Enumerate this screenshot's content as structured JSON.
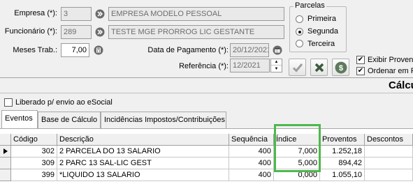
{
  "form": {
    "empresa": {
      "label": "Empresa (*):",
      "code": "3",
      "name": "EMPRESA MODELO PESSOAL"
    },
    "funcionario": {
      "label": "Funcionário (*):",
      "code": "289",
      "name": "TESTE MGE PRORROG LIC GESTANTE"
    },
    "meses_trab": {
      "label": "Meses Trab.:",
      "value": "7,00"
    },
    "data_pagamento": {
      "label": "Data de Pagamento (*):",
      "value": "20/12/2021"
    },
    "referencia": {
      "label": "Referência (*):",
      "value": "12/2021"
    }
  },
  "parcelas": {
    "title": "Parcelas",
    "options": [
      "Primeira",
      "Segunda",
      "Terceira"
    ],
    "selected": "Segunda"
  },
  "options": {
    "exibir_proventos": {
      "label": "Exibir Provent",
      "checked": true
    },
    "ordenar_em": {
      "label": "Ordenar em P",
      "checked": true
    }
  },
  "title_strip": {
    "title": "Cálcu"
  },
  "liberado": {
    "label": "Liberado p/ envio ao eSocial",
    "checked": false
  },
  "tabs": [
    {
      "label": "Eventos",
      "active": true
    },
    {
      "label": "Base de Cálculo",
      "active": false
    },
    {
      "label": "Incidências Impostos/Contribuições",
      "active": false
    }
  ],
  "grid": {
    "columns": [
      "Código",
      "Descrição",
      "Sequência",
      "Índice",
      "Proventos",
      "Descontos"
    ],
    "rows": [
      {
        "codigo": "302",
        "descricao": "2 PARCELA DO 13 SALARIO",
        "sequencia": "400",
        "indice": "7,000",
        "proventos": "1.252,18",
        "descontos": ""
      },
      {
        "codigo": "309",
        "descricao": "2 PARC 13 SAL-LIC GEST",
        "sequencia": "400",
        "indice": "5,000",
        "proventos": "894,42",
        "descontos": ""
      },
      {
        "codigo": "399",
        "descricao": "*LIQUIDO 13 SALARIO",
        "sequencia": "400",
        "indice": "0,000",
        "proventos": "1.055,10",
        "descontos": ""
      }
    ]
  },
  "colors": {
    "highlight": "#4db84d",
    "lookup_button": "#6b6b6b",
    "confirm_icon": "#9e9e9e",
    "cancel_icon": "#3d5a3d"
  }
}
